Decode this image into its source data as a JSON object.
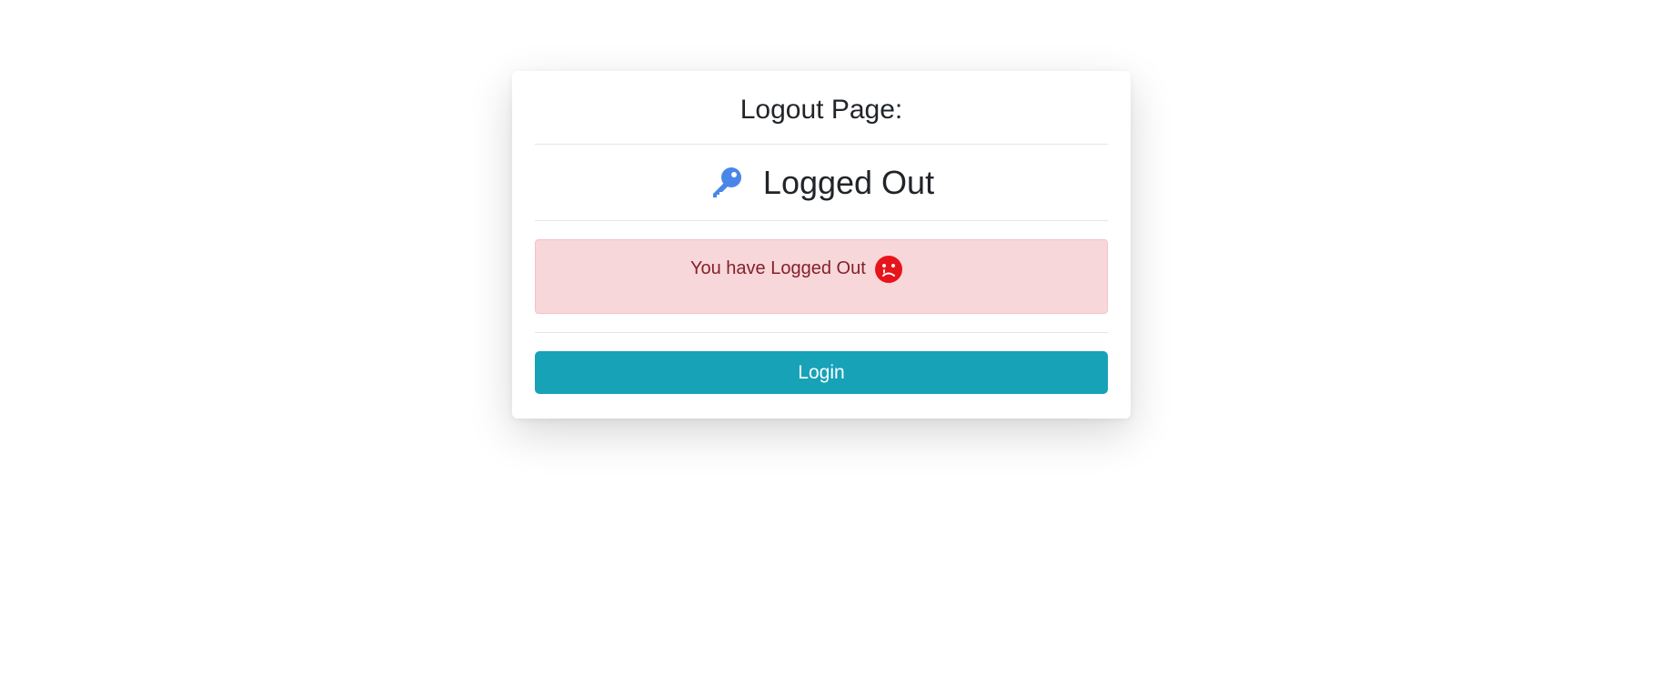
{
  "card": {
    "title": "Logout Page:",
    "status_heading": "Logged Out",
    "status_icon": "key-icon",
    "alert": {
      "message": "You have Logged Out",
      "icon": "sad-face-icon",
      "color": "#842029",
      "background": "#f8d7da"
    },
    "login_label": "Login",
    "accent": "#17a2b8"
  }
}
